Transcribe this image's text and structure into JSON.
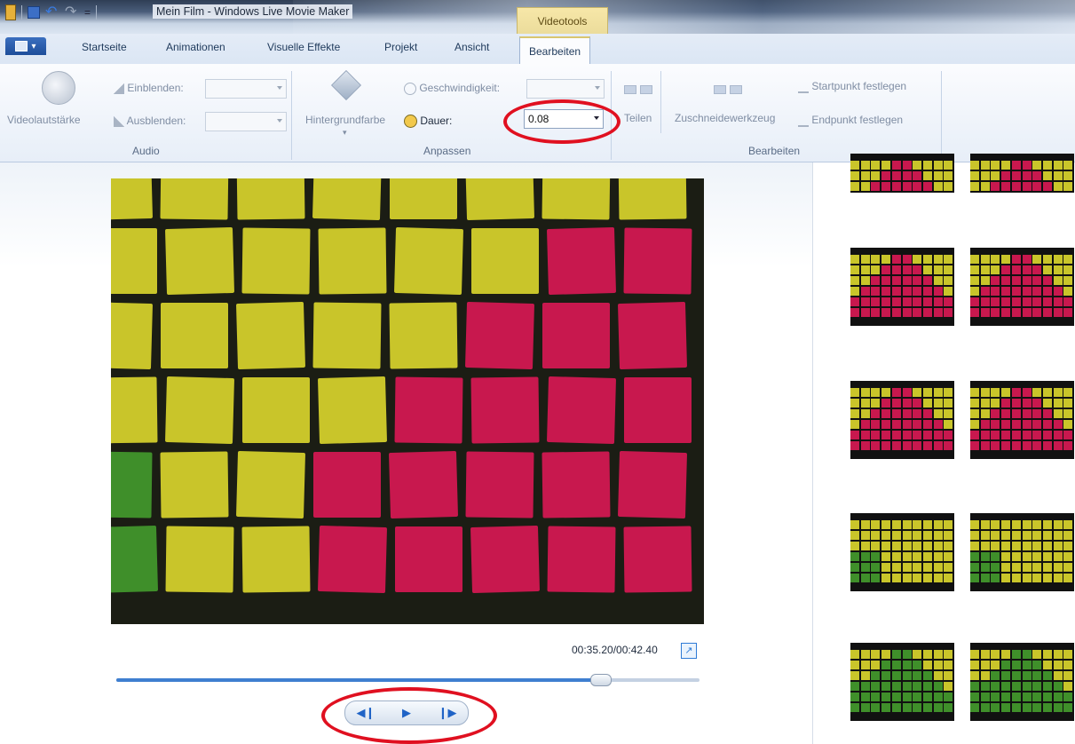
{
  "window": {
    "title": "Mein Film - Windows Live Movie Maker",
    "qat_customize_glyph": "=",
    "context_tab_group": "Videotools"
  },
  "ribbon_tabs": {
    "file_menu_icon": "file-menu-icon",
    "items": [
      "Startseite",
      "Animationen",
      "Visuelle Effekte",
      "Projekt",
      "Ansicht",
      "Bearbeiten"
    ],
    "active": "Bearbeiten"
  },
  "audio_group": {
    "label": "Audio",
    "video_volume": "Videolautstärke",
    "fade_in_label": "Einblenden:",
    "fade_in_value": "",
    "fade_out_label": "Ausblenden:",
    "fade_out_value": ""
  },
  "adjust_group": {
    "label": "Anpassen",
    "background_color": "Hintergrundfarbe",
    "speed_label": "Geschwindigkeit:",
    "speed_value": "",
    "duration_label": "Dauer:",
    "duration_value": "0.08"
  },
  "edit_group": {
    "label": "Bearbeiten",
    "split": "Teilen",
    "trim_tool": "Zuschneidewerkzeug",
    "set_start": "Startpunkt festlegen",
    "set_end": "Endpunkt festlegen"
  },
  "preview": {
    "timecode": "00:35.20/00:42.40",
    "progress": 0.83,
    "prev_frame_icon": "previous-frame-icon",
    "play_icon": "play-icon",
    "next_frame_icon": "next-frame-icon"
  },
  "colors": {
    "yellow_note": "#c9c52a",
    "pink_note": "#c8184e",
    "green_note": "#3f8f2a",
    "background_black": "#1b1d14",
    "annotation_red": "#e01020"
  },
  "annotations": {
    "highlight_color": "#e01020"
  }
}
